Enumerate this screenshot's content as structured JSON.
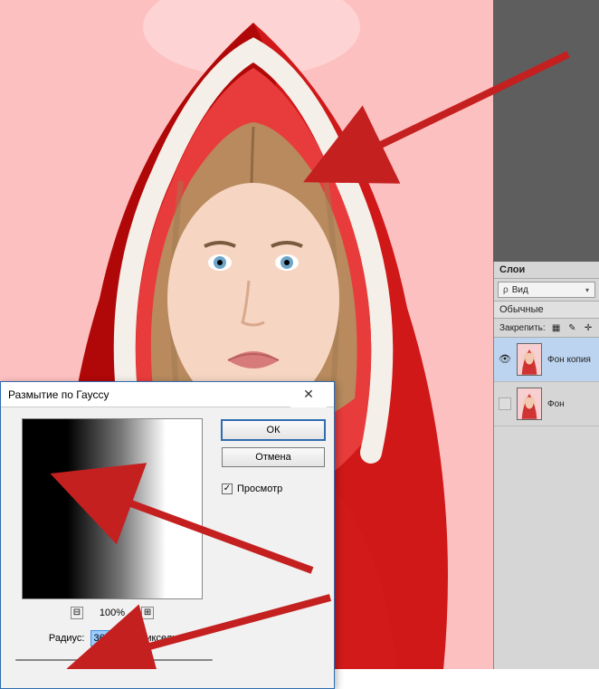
{
  "dialog": {
    "title": "Размытие по Гауссу",
    "close_label": "✕",
    "ok_label": "ОК",
    "cancel_label": "Отмена",
    "preview_checkbox_label": "Просмотр",
    "zoom_level": "100%",
    "zoom_out": "⊟",
    "zoom_in": "⊞",
    "radius_label": "Радиус:",
    "radius_value": "36,0",
    "radius_unit": "Пикселы"
  },
  "layers_panel": {
    "tab_label": "Слои",
    "filter_prefix": "ρ",
    "filter_label": "Вид",
    "blend_mode": "Обычные",
    "lock_label": "Закрепить:",
    "layers": [
      {
        "name": "Фон копия",
        "visible": true,
        "selected": true
      },
      {
        "name": "Фон",
        "visible": false,
        "selected": false
      }
    ]
  },
  "icons": {
    "eye": "👁",
    "lock_pix": "▦",
    "lock_brush": "✎",
    "lock_move": "✛",
    "checkmark": "✓",
    "chevron": "▾"
  }
}
